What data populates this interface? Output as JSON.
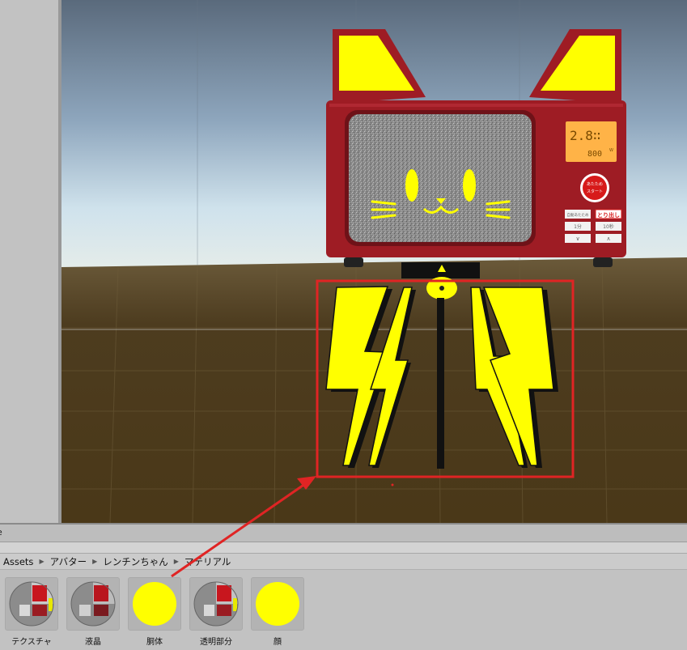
{
  "colors": {
    "annotation": "#e02424",
    "body_red": "#9e1c24",
    "ear_yellow": "#ffff00",
    "display_orange": "#ffb347",
    "floor": "#4a3a1c"
  },
  "project_tab": {
    "label": "e"
  },
  "breadcrumb": {
    "items": [
      "Assets",
      "アバター",
      "レンチンちゃん",
      "マテリアル"
    ]
  },
  "assets": [
    {
      "label": "テクスチャ",
      "icon": "textured-sphere-icon"
    },
    {
      "label": "液晶",
      "icon": "textured-sphere-icon"
    },
    {
      "label": "胴体",
      "icon": "yellow-sphere-icon"
    },
    {
      "label": "透明部分",
      "icon": "textured-sphere-icon"
    },
    {
      "label": "顔",
      "icon": "yellow-sphere-icon"
    }
  ],
  "scene": {
    "display_time": "2.8∷",
    "display_power": "800",
    "display_power_unit": "W",
    "start_button_line1": "あたため",
    "start_button_line2": "スタート",
    "panel_buttons": [
      "自動あたため",
      "とり出し",
      "1分",
      "10秒",
      "∨",
      "∧"
    ]
  }
}
